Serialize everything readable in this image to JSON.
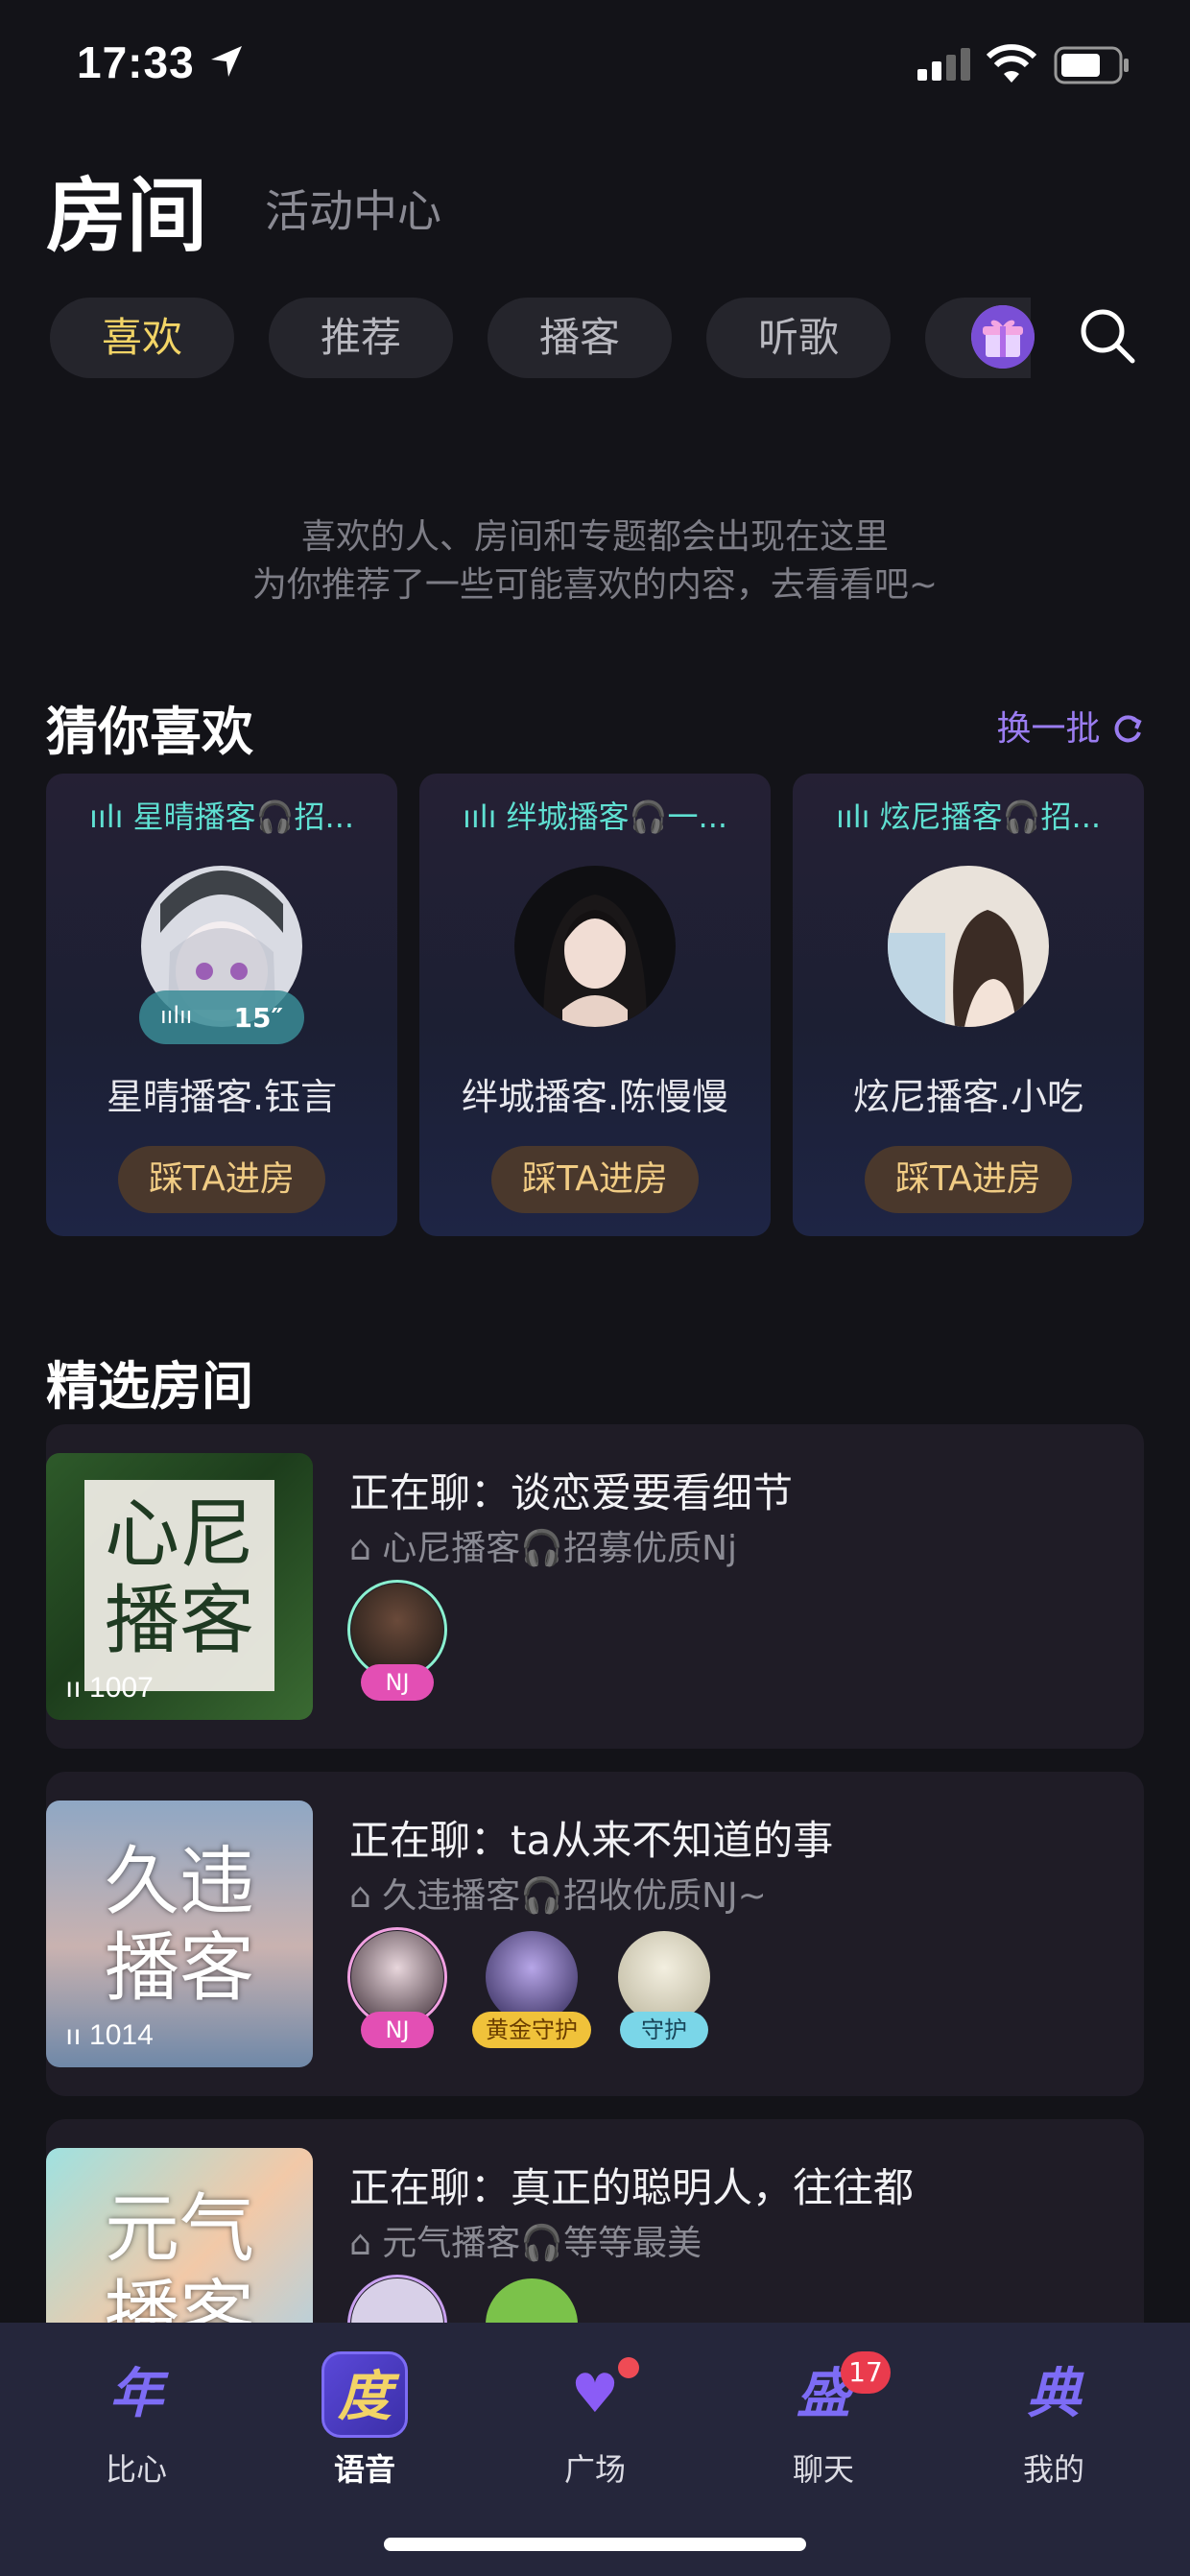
{
  "status_bar": {
    "time": "17:33"
  },
  "header": {
    "title": "房间",
    "sub_nav": "活动中心"
  },
  "tabs": [
    {
      "label": "喜欢",
      "active": true
    },
    {
      "label": "推荐"
    },
    {
      "label": "播客"
    },
    {
      "label": "听歌"
    }
  ],
  "empty_state": {
    "line1": "喜欢的人、房间和专题都会出现在这里",
    "line2": "为你推荐了一些可能喜欢的内容，去看看吧~"
  },
  "guess": {
    "title": "猜你喜欢",
    "refresh_label": "换一批",
    "cards": [
      {
        "live_room": "星晴播客🎧招...",
        "name": "星晴播客.钰言",
        "button": "踩TA进房",
        "voice_duration": "15″"
      },
      {
        "live_room": "绊城播客🎧一...",
        "name": "绊城播客.陈慢慢",
        "button": "踩TA进房"
      },
      {
        "live_room": "炫尼播客🎧招...",
        "name": "炫尼播客.小吃",
        "button": "踩TA进房"
      }
    ]
  },
  "featured": {
    "title": "精选房间",
    "rooms": [
      {
        "cover_line1": "心尼",
        "cover_line2": "播客",
        "count": "1007",
        "title": "正在聊：谈恋爱要看细节",
        "subtitle": "心尼播客🎧招募优质Nj",
        "tags": [
          "NJ"
        ]
      },
      {
        "cover_line1": "久违",
        "cover_line2": "播客",
        "count": "1014",
        "title": "正在聊：ta从来不知道的事",
        "subtitle": "久违播客🎧招收优质NJ~",
        "tags": [
          "NJ",
          "黄金守护",
          "守护"
        ]
      },
      {
        "cover_line1": "元气",
        "cover_line2": "播客",
        "title": "正在聊：真正的聪明人，往往都",
        "subtitle": "元气播客🎧等等最美"
      }
    ]
  },
  "bottom_nav": [
    {
      "label": "比心",
      "glyph": "年"
    },
    {
      "label": "语音",
      "glyph": "度",
      "active": true
    },
    {
      "label": "广场",
      "glyph": "♥"
    },
    {
      "label": "聊天",
      "glyph": "盛",
      "badge": "17"
    },
    {
      "label": "我的",
      "glyph": "典"
    }
  ],
  "colors": {
    "accent_yellow": "#f2d466",
    "accent_purple": "#9a7cf0",
    "live_teal": "#5fe0d2"
  }
}
